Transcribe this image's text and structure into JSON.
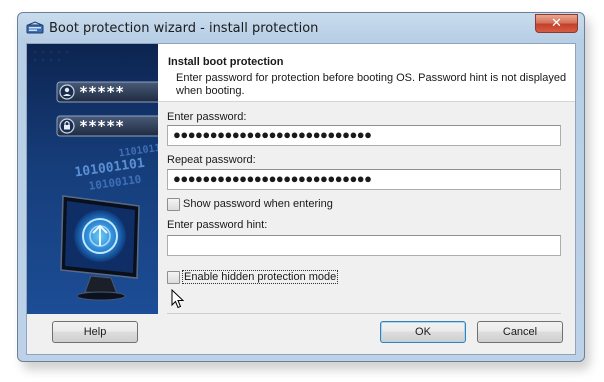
{
  "window": {
    "title": "Boot protection wizard - install protection",
    "close_label": "✕"
  },
  "header": {
    "title": "Install boot protection",
    "description": "Enter password for protection before booting OS. Password hint is not displayed when booting."
  },
  "form": {
    "password_label": "Enter password:",
    "password_value": "●●●●●●●●●●●●●●●●●●●●●●●●●●●",
    "repeat_label": "Repeat password:",
    "repeat_value": "●●●●●●●●●●●●●●●●●●●●●●●●●●●",
    "show_password_label": "Show password when entering",
    "show_password_checked": false,
    "hint_label": "Enter password hint:",
    "hint_value": "",
    "hidden_mode_label": "Enable hidden protection mode",
    "hidden_mode_checked": false
  },
  "buttons": {
    "help": "Help",
    "ok": "OK",
    "cancel": "Cancel"
  },
  "banner": {
    "mask_1": "*****",
    "mask_2": "*****",
    "binary_1": "101001101",
    "binary_2": "10100110",
    "binary_3": "1101011"
  },
  "icons": [
    "app-key-icon",
    "close-icon",
    "user-icon",
    "lock-icon",
    "monitor-icon",
    "mouse-cursor-icon"
  ],
  "colors": {
    "banner_dark": "#0d2450",
    "banner_mid": "#1c4d96",
    "accent_blue": "#3c7fb1"
  }
}
